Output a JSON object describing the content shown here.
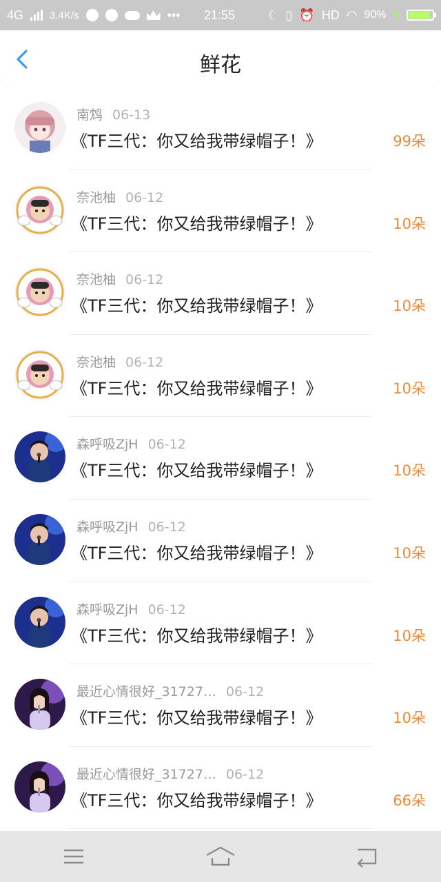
{
  "status_bar": {
    "network": "4G",
    "speed": "3.4K/s",
    "more": "•••",
    "time": "21:55",
    "hd": "HD",
    "battery_pct": "90%",
    "battery_level": 0.9
  },
  "header": {
    "title": "鲜花"
  },
  "accent_color": "#e78a3c",
  "back_color": "#3e9be9",
  "items": [
    {
      "user": "南鸩",
      "date": "06-13",
      "work": "《TF三代：你又给我带绿帽子！》",
      "count": "99朵",
      "avatar": "anime-girl"
    },
    {
      "user": "奈池柚",
      "date": "06-12",
      "work": "《TF三代：你又给我带绿帽子！》",
      "count": "10朵",
      "avatar": "astronaut-kid"
    },
    {
      "user": "奈池柚",
      "date": "06-12",
      "work": "《TF三代：你又给我带绿帽子！》",
      "count": "10朵",
      "avatar": "astronaut-kid"
    },
    {
      "user": "奈池柚",
      "date": "06-12",
      "work": "《TF三代：你又给我带绿帽子！》",
      "count": "10朵",
      "avatar": "astronaut-kid"
    },
    {
      "user": "森呼吸ZjH",
      "date": "06-12",
      "work": "《TF三代：你又给我带绿帽子！》",
      "count": "10朵",
      "avatar": "singer-blue"
    },
    {
      "user": "森呼吸ZjH",
      "date": "06-12",
      "work": "《TF三代：你又给我带绿帽子！》",
      "count": "10朵",
      "avatar": "singer-blue"
    },
    {
      "user": "森呼吸ZjH",
      "date": "06-12",
      "work": "《TF三代：你又给我带绿帽子！》",
      "count": "10朵",
      "avatar": "singer-blue"
    },
    {
      "user": "最近心情很好_31727…",
      "date": "06-12",
      "work": "《TF三代：你又给我带绿帽子！》",
      "count": "10朵",
      "avatar": "singer-purple"
    },
    {
      "user": "最近心情很好_31727…",
      "date": "06-12",
      "work": "《TF三代：你又给我带绿帽子！》",
      "count": "66朵",
      "avatar": "singer-purple"
    }
  ]
}
